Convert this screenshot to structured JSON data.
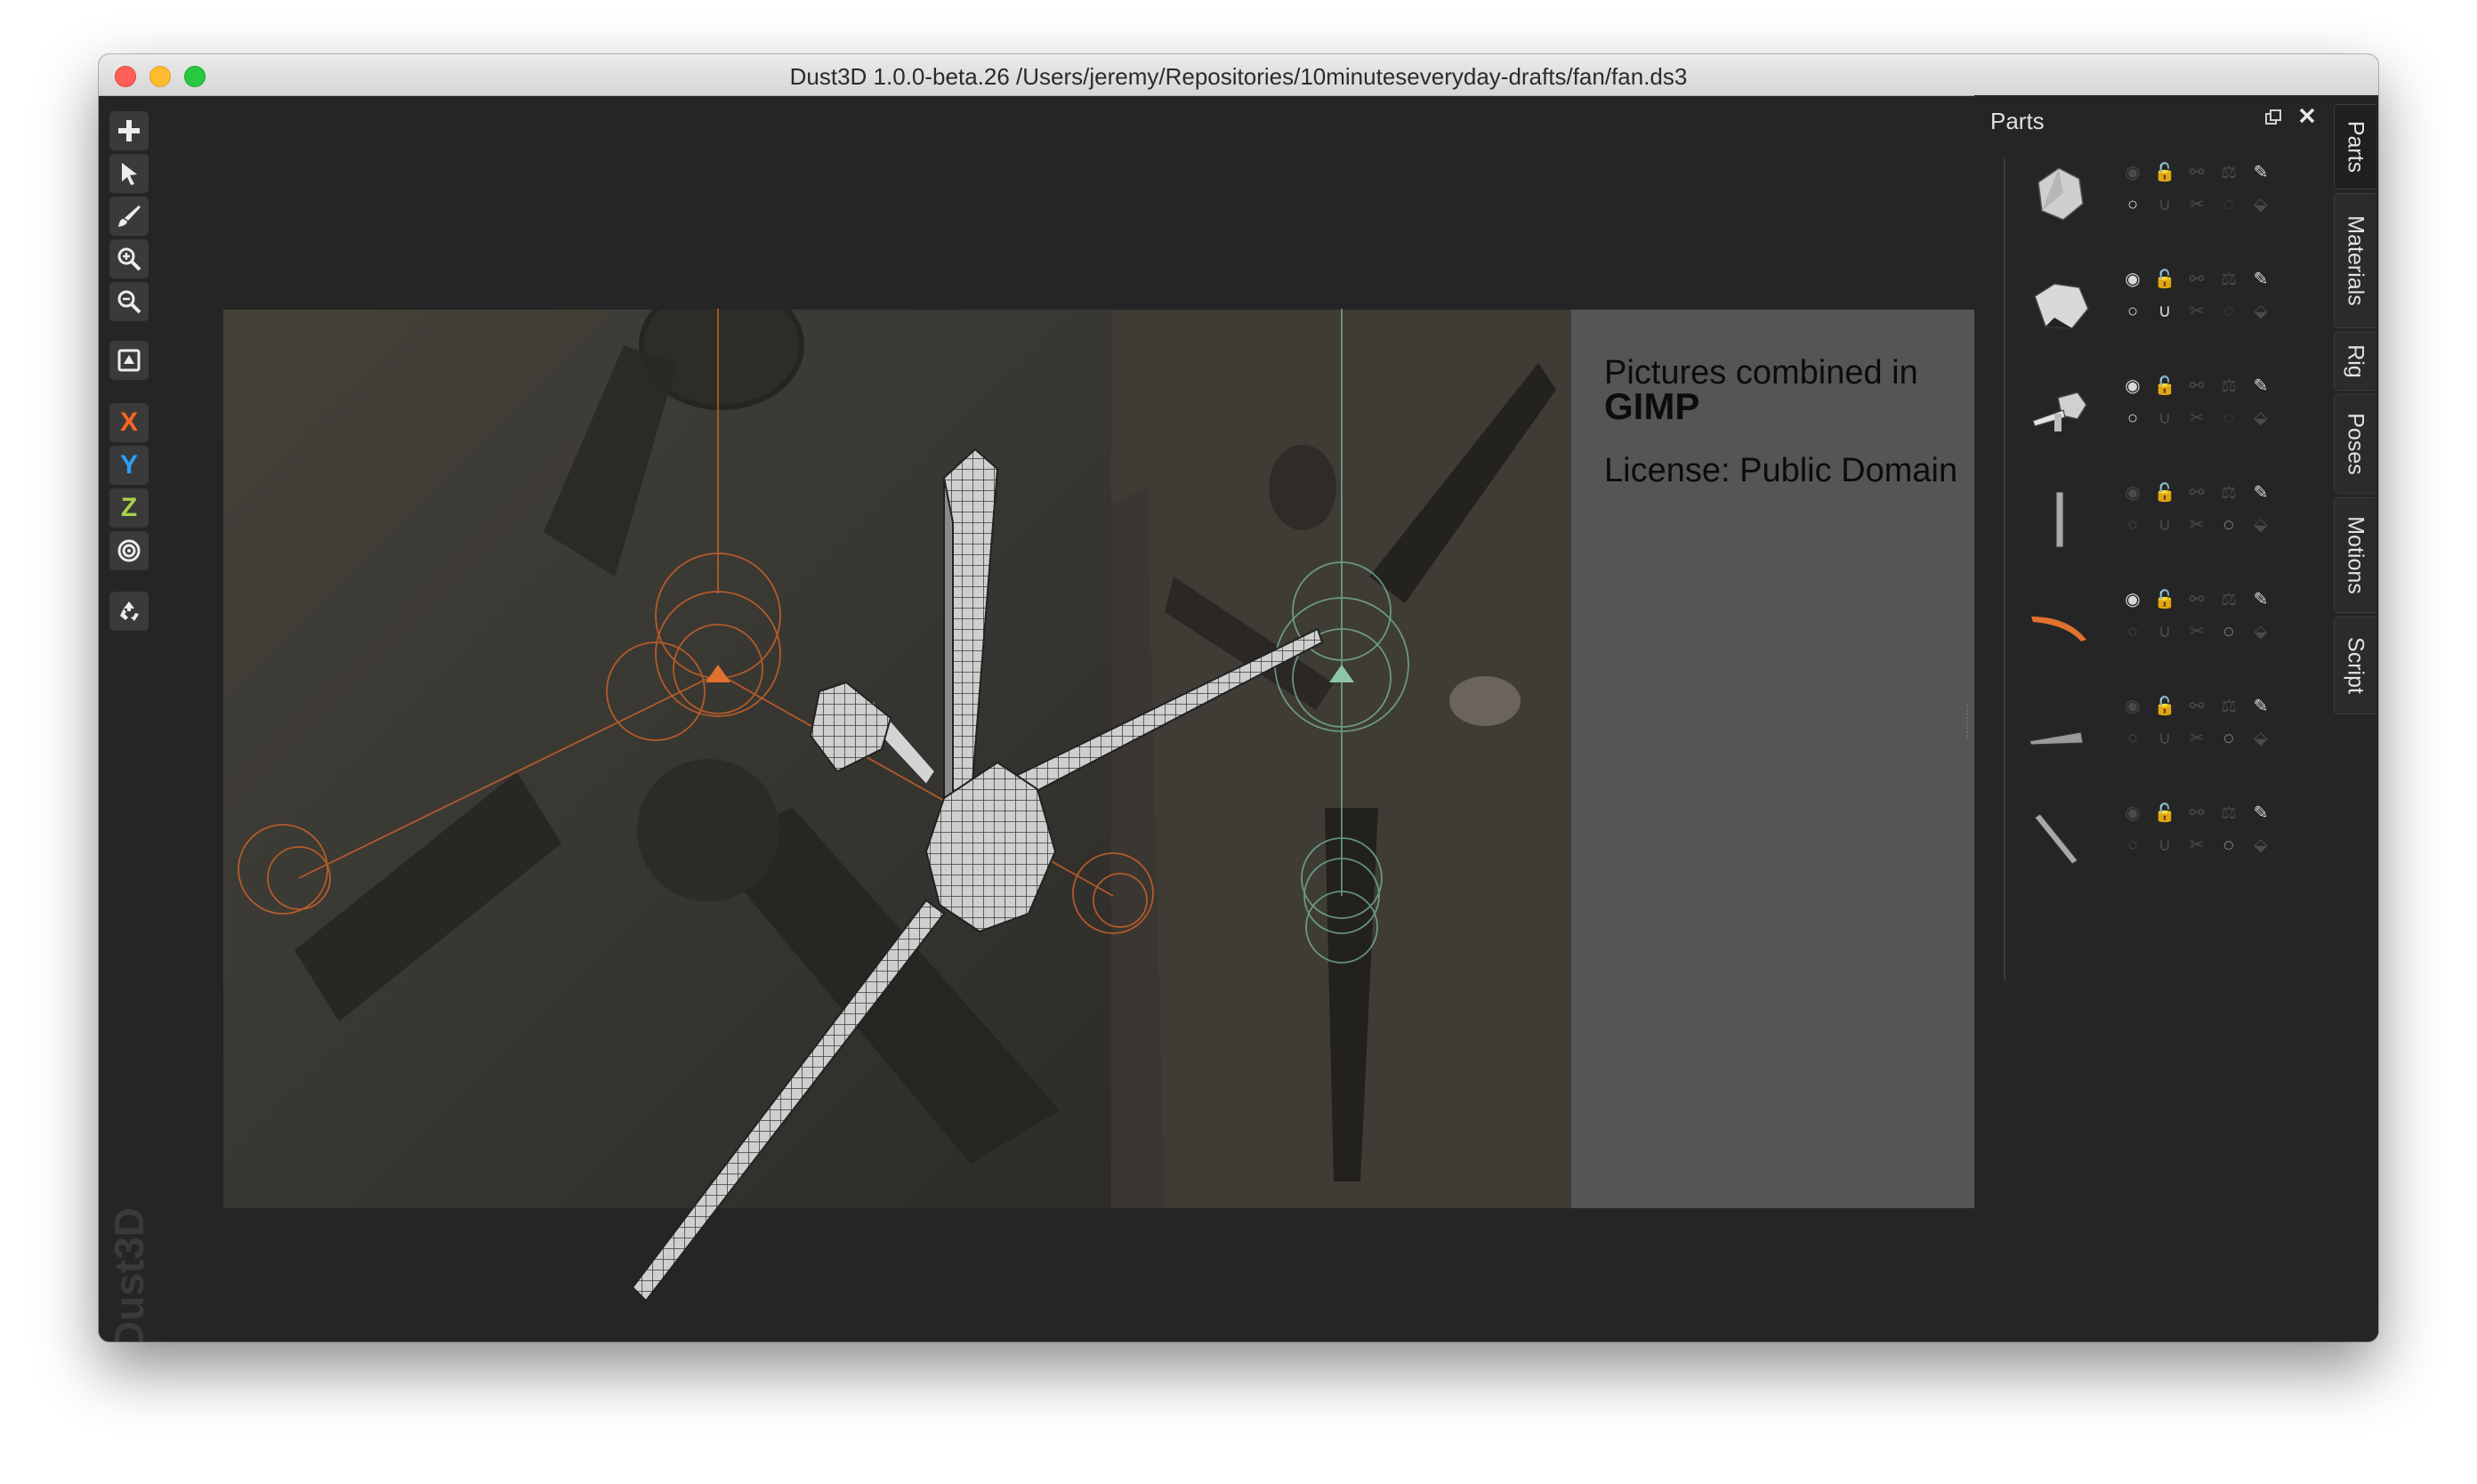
{
  "window": {
    "title": "Dust3D 1.0.0-beta.26 /Users/jeremy/Repositories/10minuteseveryday-drafts/fan/fan.ds3"
  },
  "toolbar": {
    "tools": [
      {
        "icon": "add-icon"
      },
      {
        "icon": "select-pointer-icon"
      },
      {
        "icon": "paint-brush-icon"
      },
      {
        "icon": "zoom-in-icon"
      },
      {
        "icon": "zoom-out-icon"
      },
      {
        "icon": "camera-frame-icon"
      },
      {
        "label": "X"
      },
      {
        "label": "Y"
      },
      {
        "label": "Z"
      },
      {
        "icon": "radial-target-icon"
      },
      {
        "icon": "recycle-icon"
      }
    ],
    "brand": "Dust3D"
  },
  "reference": {
    "note_line1": "Pictures combined in",
    "note_line2": "GIMP",
    "note_line3": "License: Public Domain"
  },
  "parts_panel": {
    "title": "Parts",
    "parts": [
      {
        "shape": "rock",
        "color": "#cfcfcf",
        "visible": false
      },
      {
        "shape": "rock-large",
        "color": "#d8d8d8",
        "visible": true
      },
      {
        "shape": "motor-cap",
        "color": "#d0d0d0",
        "visible": true
      },
      {
        "shape": "thin-bar",
        "color": "#aaaaaa",
        "visible": false
      },
      {
        "shape": "blade-orange",
        "color": "#e0712e",
        "visible": true
      },
      {
        "shape": "blade-flat",
        "color": "#9a9a9a",
        "visible": false
      },
      {
        "shape": "rod-diagonal",
        "color": "#a8a8a8",
        "visible": false
      }
    ]
  },
  "side_tabs": [
    "Parts",
    "Materials",
    "Rig",
    "Poses",
    "Motions",
    "Script"
  ],
  "colors": {
    "accent_orange": "#e0712e",
    "accent_green": "#7ab79a",
    "axis_x": "#fc6621",
    "axis_y": "#2a9ff6",
    "axis_z": "#aad14a"
  }
}
